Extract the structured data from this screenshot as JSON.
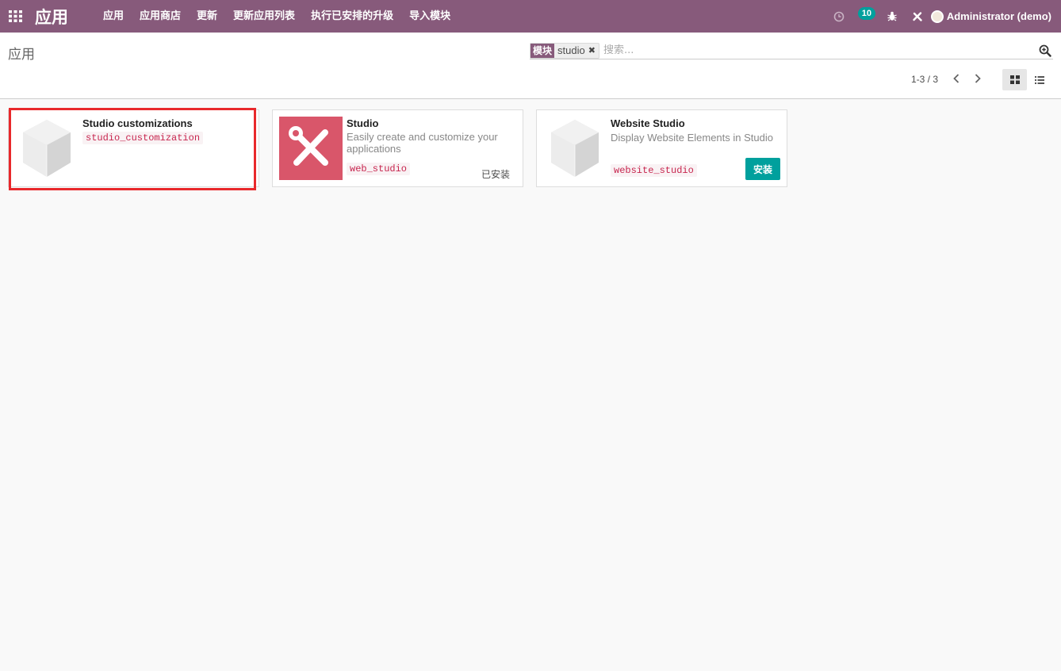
{
  "navbar": {
    "brand": "应用",
    "menu": [
      "应用",
      "应用商店",
      "更新",
      "更新应用列表",
      "执行已安排的升级",
      "导入模块"
    ],
    "notification_count": "10",
    "user_name": "Administrator (demo)",
    "color": "#875a7b"
  },
  "control_panel": {
    "breadcrumb": "应用",
    "search": {
      "facet_category": "模块",
      "facet_value": "studio",
      "facet_remove": "✖",
      "placeholder": "搜索..."
    },
    "pager": "1-3 / 3",
    "views": [
      "kanban",
      "list"
    ],
    "active_view": "kanban"
  },
  "cards": [
    {
      "title": "Studio customizations",
      "description": "",
      "technical_name": "studio_customization",
      "icon": "module-cube-icon",
      "status": ""
    },
    {
      "title": "Studio",
      "description": "Easily create and customize your applications",
      "technical_name": "web_studio",
      "icon": "studio-tools-icon",
      "status": "已安装"
    },
    {
      "title": "Website Studio",
      "description": "Display Website Elements in Studio",
      "technical_name": "website_studio",
      "icon": "module-cube-icon",
      "action": "安装"
    }
  ],
  "colors": {
    "install_button": "#00a09d",
    "highlight": "#e8282b",
    "studio_icon_bg": "#d9566a"
  }
}
